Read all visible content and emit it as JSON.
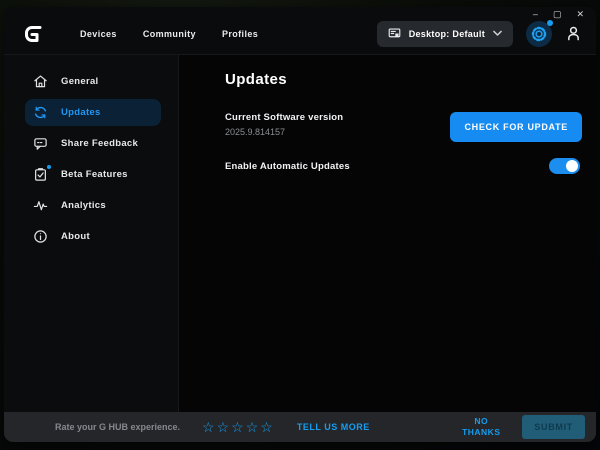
{
  "window": {
    "controls": {
      "minimize": "–",
      "maximize": "▢",
      "close": "✕"
    }
  },
  "topbar": {
    "nav": [
      {
        "label": "Devices"
      },
      {
        "label": "Community"
      },
      {
        "label": "Profiles"
      }
    ],
    "profile_selector": {
      "label": "Desktop: Default"
    },
    "icons": [
      "desktop-profile",
      "chevron-down",
      "settings-gear",
      "user"
    ]
  },
  "sidebar": {
    "items": [
      {
        "label": "General",
        "icon": "home",
        "selected": false
      },
      {
        "label": "Updates",
        "icon": "refresh",
        "selected": true
      },
      {
        "label": "Share Feedback",
        "icon": "chat-bubble",
        "selected": false
      },
      {
        "label": "Beta Features",
        "icon": "clipboard-check",
        "selected": false,
        "badge": true
      },
      {
        "label": "Analytics",
        "icon": "pulse",
        "selected": false
      },
      {
        "label": "About",
        "icon": "info",
        "selected": false
      }
    ]
  },
  "main": {
    "title": "Updates",
    "version": {
      "label": "Current Software version",
      "value": "2025.9.814157",
      "button": "CHECK FOR UPDATE"
    },
    "auto_updates": {
      "label": "Enable Automatic Updates",
      "enabled": true
    }
  },
  "footer": {
    "prompt": "Rate your G HUB experience.",
    "star_char": "☆",
    "star_count": 5,
    "tell_us_more": "TELL US MORE",
    "no_thanks": "NO THANKS",
    "submit": "SUBMIT"
  },
  "colors": {
    "accent_blue": "#169df0",
    "button_blue": "#168bf1",
    "selected_item_bg": "#0b2236",
    "footer_bg": "#242629",
    "submit_bg": "#215d76"
  }
}
